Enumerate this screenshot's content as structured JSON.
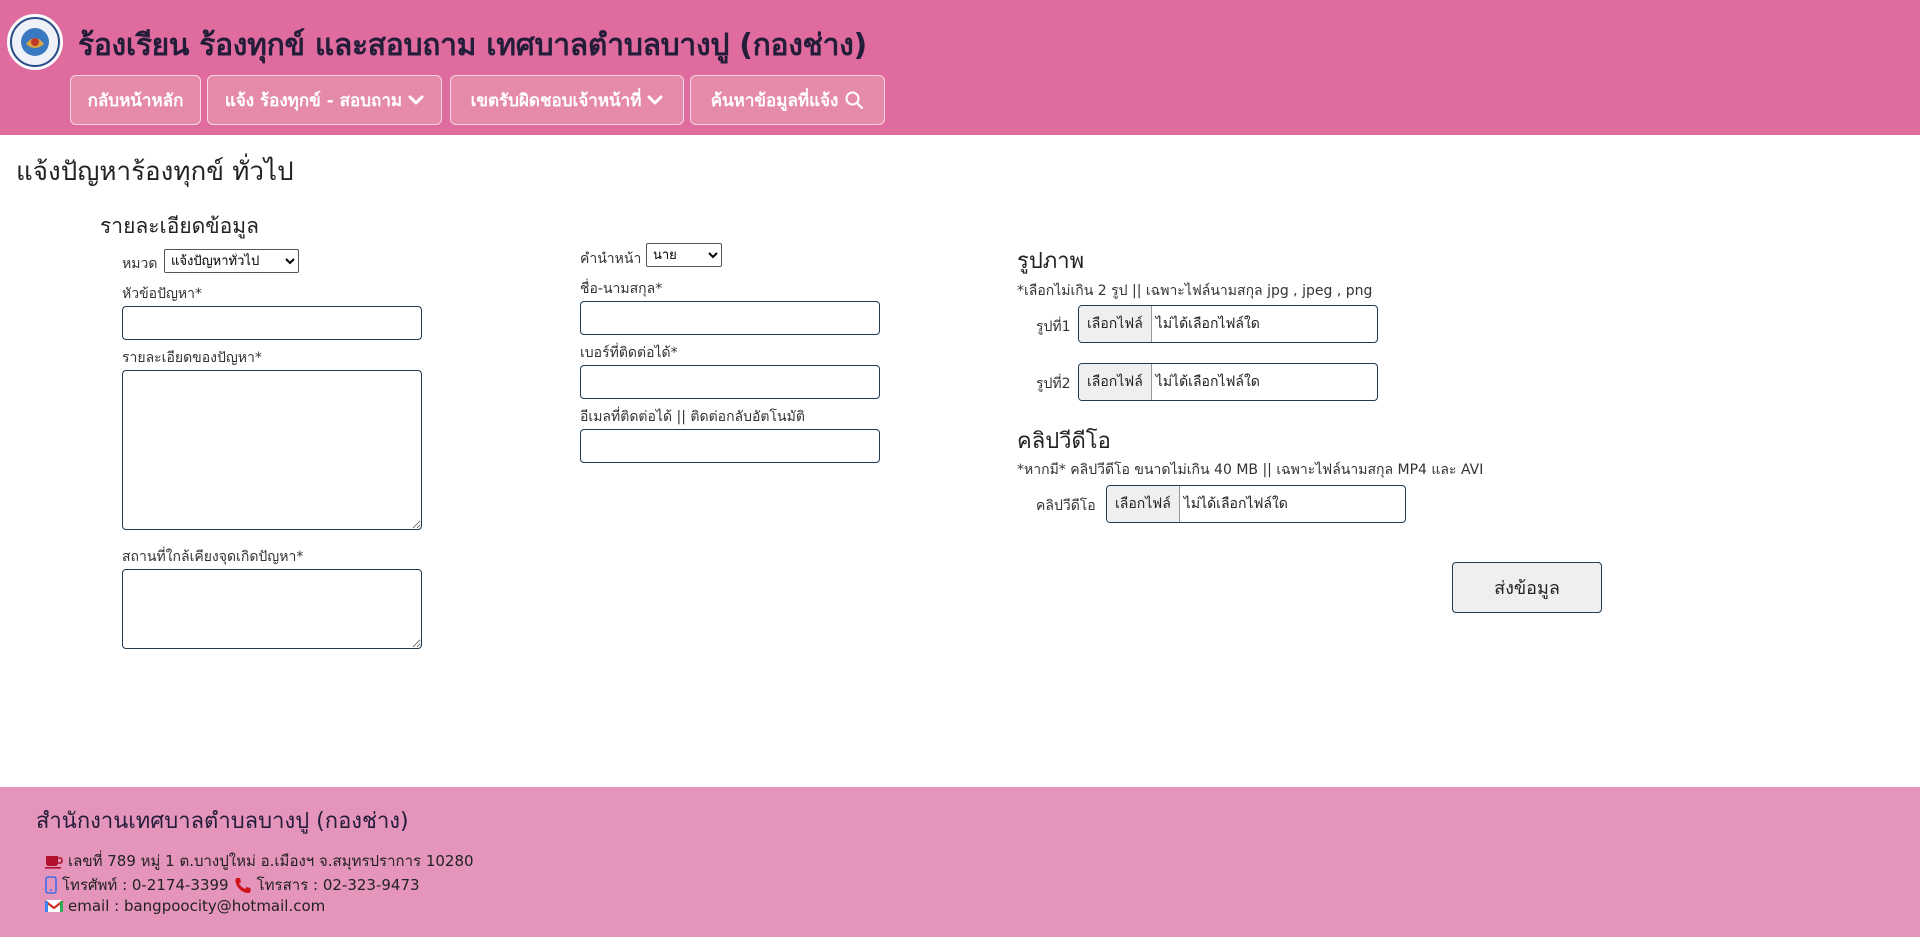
{
  "header": {
    "title": "ร้องเรียน ร้องทุกข์ และสอบถาม เทศบาลตำบลบางปู (กองช่าง)",
    "nav": [
      {
        "label": "กลับหน้าหลัก"
      },
      {
        "label": "แจ้ง ร้องทุกข์ - สอบถาม",
        "icon": "chevron-down-icon"
      },
      {
        "label": "เขตรับผิดชอบเจ้าหน้าที่",
        "icon": "chevron-down-icon"
      },
      {
        "label": "ค้นหาข้อมูลที่แจ้ง",
        "icon": "search-icon"
      }
    ]
  },
  "main": {
    "page_title": "แจ้งปัญหาร้องทุกข์ ทั่วไป",
    "details": {
      "heading": "รายละเอียดข้อมูล",
      "category_label": "หมวด",
      "category_value": "แจ้งปัญหาทั่วไป",
      "subject_label": "หัวข้อปัญหา*",
      "subject_value": "",
      "description_label": "รายละเอียดของปัญหา*",
      "description_value": "",
      "location_label": "สถานที่ใกล้เคียงจุดเกิดปัญหา*",
      "location_value": ""
    },
    "contact": {
      "prefix_label": "คำนำหน้า",
      "prefix_value": "นาย",
      "name_label": "ชื่อ-นามสกุล*",
      "name_value": "",
      "phone_label": "เบอร์ที่ติดต่อได้*",
      "phone_value": "",
      "email_label": "อีเมลที่ติดต่อได้ || ติดต่อกลับอัตโนมัติ",
      "email_value": ""
    },
    "images": {
      "heading": "รูปภาพ",
      "hint": "*เลือกไม่เกิน 2 รูป || เฉพาะไฟล์นามสกุล jpg , jpeg , png",
      "image1_label": "รูปที่1",
      "image2_label": "รูปที่2",
      "choose_button": "เลือกไฟล์",
      "no_file": "ไม่ได้เลือกไฟล์ใด"
    },
    "video": {
      "heading": "คลิปวีดีโอ",
      "hint": "*หากมี* คลิปวีดีโอ ขนาดไม่เกิน 40 MB || เฉพาะไฟล์นามสกุล MP4 และ AVI",
      "label": "คลิปวีดีโอ",
      "choose_button": "เลือกไฟล์",
      "no_file": "ไม่ได้เลือกไฟล์ใด"
    },
    "submit_label": "ส่งข้อมูล"
  },
  "footer": {
    "title": "สำนักงานเทศบาลตำบลบางปู (กองช่าง)",
    "address": "เลขที่ 789 หมู่ 1 ต.บางปูใหม่ อ.เมืองฯ จ.สมุทรปราการ 10280",
    "phone": "โทรศัพท์ : 0-2174-3399",
    "fax": "โทรสาร : 02-323-9473",
    "email": "email : bangpoocity@hotmail.com"
  },
  "colors": {
    "header_bg": "#e06c9f",
    "nav_button_bg": "#e68aa9",
    "footer_bg": "#e595bb",
    "title_text": "#231d3a"
  }
}
